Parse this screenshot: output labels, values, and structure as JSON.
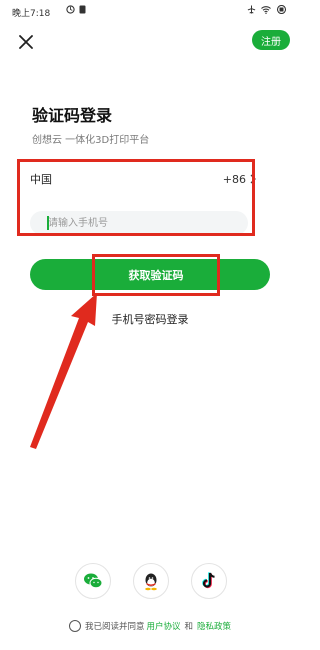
{
  "status_bar": {
    "time": "晚上7:18"
  },
  "header": {
    "register_label": "注册"
  },
  "page": {
    "title": "验证码登录",
    "subtitle": "创想云 一体化3D打印平台"
  },
  "form": {
    "country_name": "中国",
    "country_code": "+86",
    "phone_placeholder": "请输入手机号",
    "get_code_label": "获取验证码",
    "password_login_label": "手机号密码登录"
  },
  "social": {
    "items": [
      {
        "name": "wechat-icon"
      },
      {
        "name": "qq-icon"
      },
      {
        "name": "tiktok-icon"
      }
    ]
  },
  "agreement": {
    "prefix": "我已阅读并同意",
    "user_agreement": "用户协议",
    "and": "和",
    "privacy_policy": "隐私政策"
  },
  "colors": {
    "brand_green": "#1aad3a",
    "annotation_red": "#e02a1e"
  }
}
